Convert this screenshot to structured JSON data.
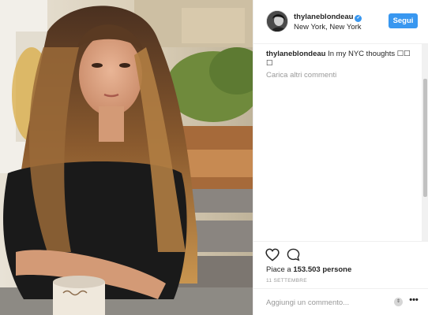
{
  "header": {
    "username": "thylaneblondeau",
    "location": "New York, New York",
    "follow_label": "Segui"
  },
  "caption": {
    "username": "thylaneblondeau",
    "text": "In my NYC thoughts ☐☐ ☐"
  },
  "comments": {
    "load_more": "Carica altri commenti"
  },
  "actions": {
    "likes_prefix": "Piace a",
    "likes_count": "153.503",
    "likes_suffix": "persone",
    "date": "11 SETTEMBRE"
  },
  "comment_box": {
    "placeholder": "Aggiungi un commento..."
  },
  "colors": {
    "accent": "#3897f0",
    "text": "#262626",
    "muted": "#999999"
  },
  "icons": [
    "verified-badge-icon",
    "heart-icon",
    "comment-icon",
    "updown-icon",
    "more-options-icon"
  ]
}
